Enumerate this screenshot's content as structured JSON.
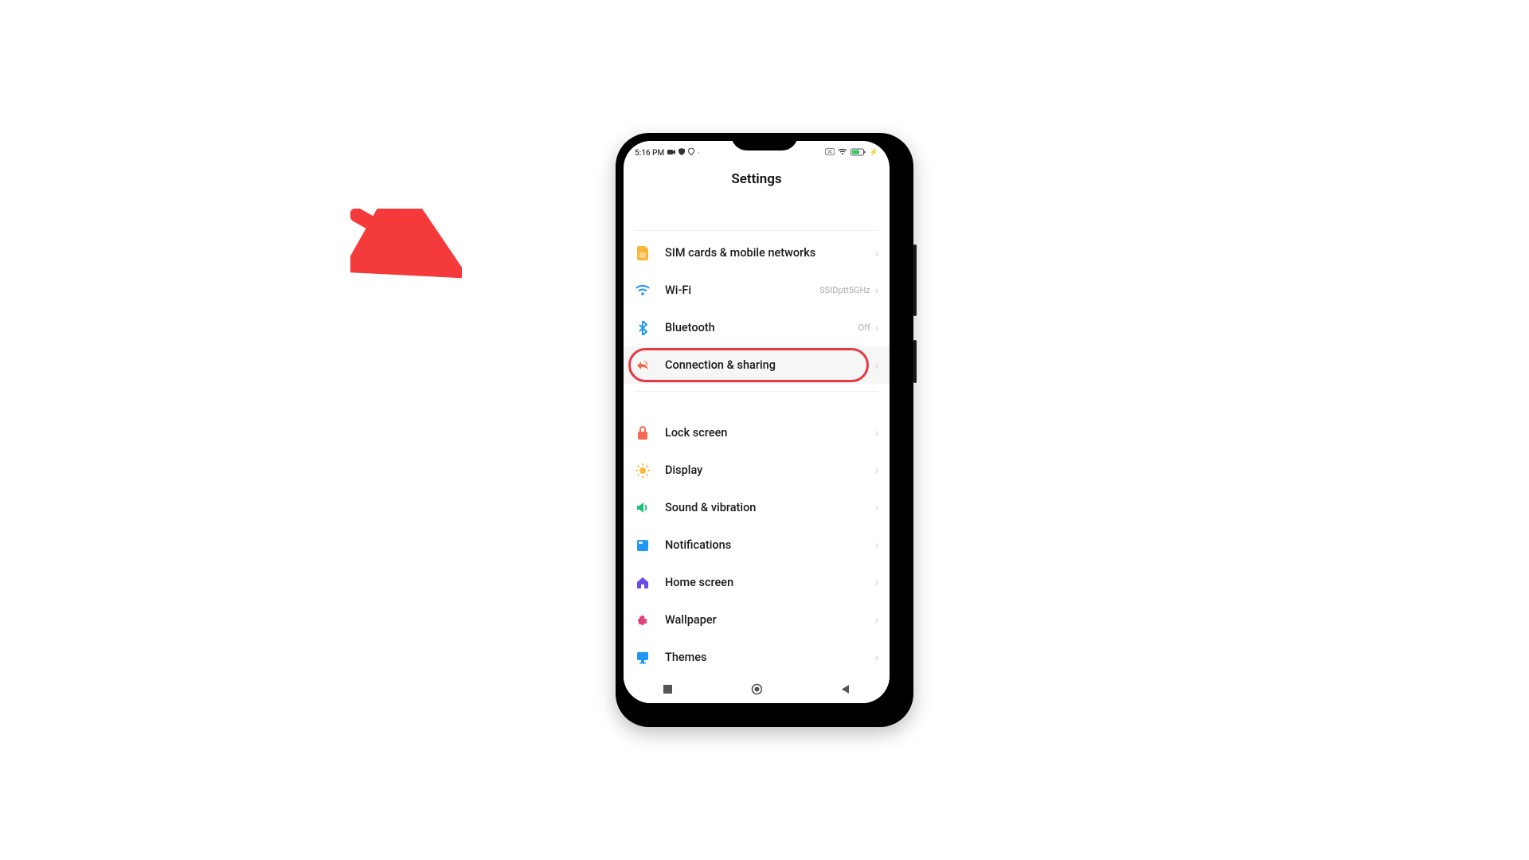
{
  "status": {
    "time": "5:16 PM"
  },
  "header": "Settings",
  "rows": [
    {
      "label": "SIM cards & mobile networks",
      "value": ""
    },
    {
      "label": "Wi-Fi",
      "value": "SSIDptt5GHz"
    },
    {
      "label": "Bluetooth",
      "value": "Off"
    },
    {
      "label": "Connection & sharing",
      "value": ""
    },
    {
      "label": "Lock screen",
      "value": ""
    },
    {
      "label": "Display",
      "value": ""
    },
    {
      "label": "Sound & vibration",
      "value": ""
    },
    {
      "label": "Notifications",
      "value": ""
    },
    {
      "label": "Home screen",
      "value": ""
    },
    {
      "label": "Wallpaper",
      "value": ""
    },
    {
      "label": "Themes",
      "value": ""
    }
  ]
}
